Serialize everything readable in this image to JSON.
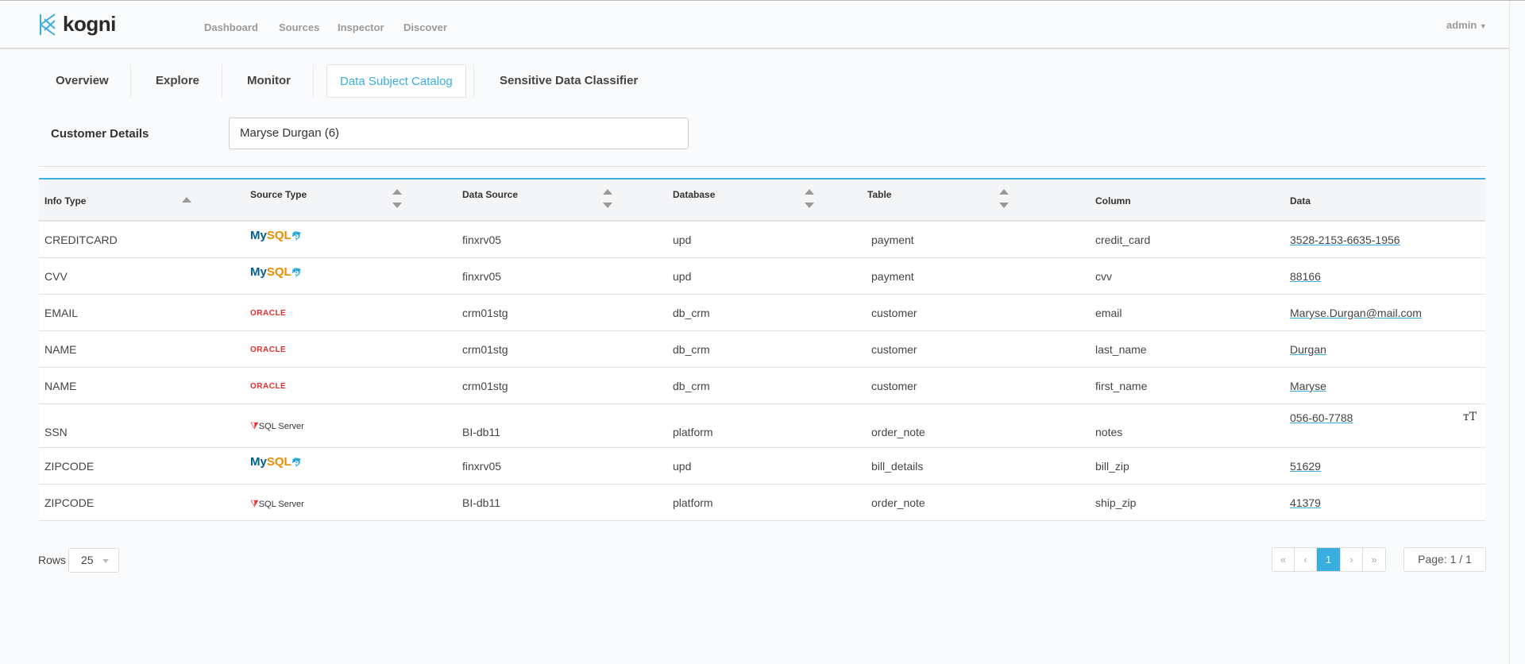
{
  "header": {
    "brand": "kogni",
    "nav": [
      "Dashboard",
      "Sources",
      "Inspector",
      "Discover"
    ],
    "user": "admin"
  },
  "tabs": [
    "Overview",
    "Explore",
    "Monitor",
    "Data Subject Catalog",
    "Sensitive Data Classifier"
  ],
  "active_tab": "Data Subject Catalog",
  "customer": {
    "label": "Customer Details",
    "value": "Maryse Durgan (6)"
  },
  "table": {
    "columns": [
      "Info Type",
      "Source Type",
      "Data Source",
      "Database",
      "Table",
      "Column",
      "Data"
    ],
    "rows": [
      {
        "info": "CREDITCARD",
        "source_type": "MySQL",
        "source": "finxrv05",
        "database": "upd",
        "table": "payment",
        "column": "credit_card",
        "data": "3528-2153-6635-1956"
      },
      {
        "info": "CVV",
        "source_type": "MySQL",
        "source": "finxrv05",
        "database": "upd",
        "table": "payment",
        "column": "cvv",
        "data": "88166"
      },
      {
        "info": "EMAIL",
        "source_type": "ORACLE",
        "source": "crm01stg",
        "database": "db_crm",
        "table": "customer",
        "column": "email",
        "data": "Maryse.Durgan@mail.com"
      },
      {
        "info": "NAME",
        "source_type": "ORACLE",
        "source": "crm01stg",
        "database": "db_crm",
        "table": "customer",
        "column": "last_name",
        "data": "Durgan"
      },
      {
        "info": "NAME",
        "source_type": "ORACLE",
        "source": "crm01stg",
        "database": "db_crm",
        "table": "customer",
        "column": "first_name",
        "data": "Maryse"
      },
      {
        "info": "SSN",
        "source_type": "SQL Server",
        "source": "BI-db11",
        "database": "platform",
        "table": "order_note",
        "column": "notes",
        "data": "056-60-7788"
      },
      {
        "info": "ZIPCODE",
        "source_type": "MySQL",
        "source": "finxrv05",
        "database": "upd",
        "table": "bill_details",
        "column": "bill_zip",
        "data": "51629"
      },
      {
        "info": "ZIPCODE",
        "source_type": "SQL Server",
        "source": "BI-db11",
        "database": "platform",
        "table": "order_note",
        "column": "ship_zip",
        "data": "41379"
      }
    ]
  },
  "footer": {
    "rows_label": "Rows",
    "rows_value": "25",
    "pager": [
      "«",
      "‹",
      "1",
      "›",
      "»"
    ],
    "page_info": "Page: 1 / 1"
  }
}
